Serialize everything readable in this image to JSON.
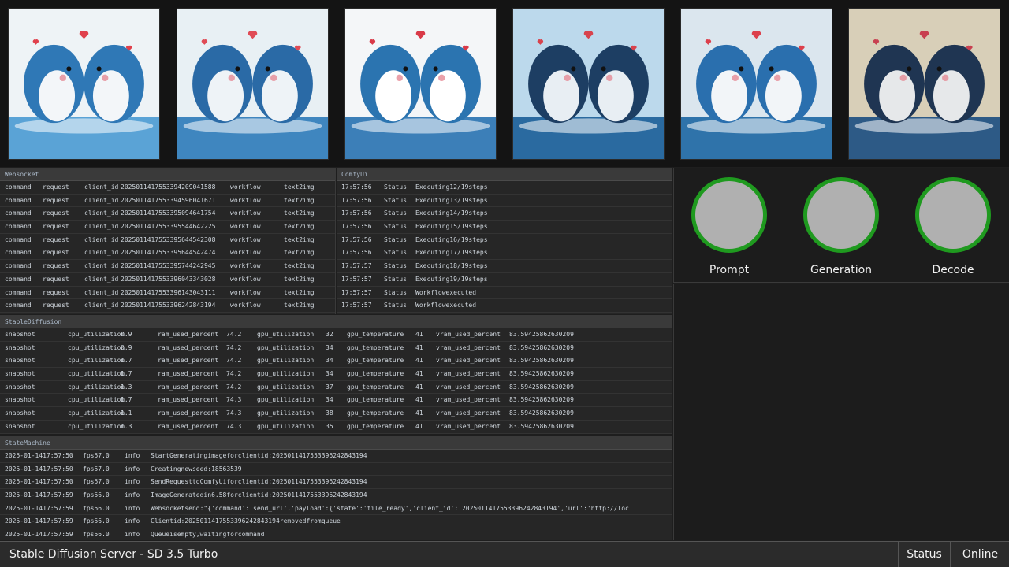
{
  "gallery": {
    "images": [
      {
        "description": "whales-heart-1"
      },
      {
        "description": "whales-heart-2"
      },
      {
        "description": "whales-heart-3"
      },
      {
        "description": "whales-heart-4"
      },
      {
        "description": "whales-heart-5"
      },
      {
        "description": "whales-heart-6"
      }
    ]
  },
  "websocket": {
    "title": "Websocket",
    "rows": [
      [
        "command",
        "request",
        "client_id",
        "20250114175533942090415 88",
        "workflow",
        "text2img"
      ],
      [
        "command",
        "request",
        "client_id",
        "20250114175533945960416 71",
        "workflow",
        "text2img"
      ],
      [
        "command",
        "request",
        "client_id",
        "20250114175533950946417 54",
        "workflow",
        "text2img"
      ],
      [
        "command",
        "request",
        "client_id",
        "20250114175533955446422 25",
        "workflow",
        "text2img"
      ],
      [
        "command",
        "request",
        "client_id",
        "20250114175533956445423 08",
        "workflow",
        "text2img"
      ],
      [
        "command",
        "request",
        "client_id",
        "20250114175533956445424 74",
        "workflow",
        "text2img"
      ],
      [
        "command",
        "request",
        "client_id",
        "20250114175533957442429 45",
        "workflow",
        "text2img"
      ],
      [
        "command",
        "request",
        "client_id",
        "20250114175533960433430 28",
        "workflow",
        "text2img"
      ],
      [
        "command",
        "request",
        "client_id",
        "20250114175533961430431 11",
        "workflow",
        "text2img"
      ],
      [
        "command",
        "request",
        "client_id",
        "20250114175533962428431 94",
        "workflow",
        "text2img"
      ]
    ]
  },
  "comfyui": {
    "title": "ComfyUi",
    "rows": [
      [
        "17:57:56",
        "Status",
        "Executing 12/19 steps"
      ],
      [
        "17:57:56",
        "Status",
        "Executing 13/19 steps"
      ],
      [
        "17:57:56",
        "Status",
        "Executing 14/19 steps"
      ],
      [
        "17:57:56",
        "Status",
        "Executing 15/19 steps"
      ],
      [
        "17:57:56",
        "Status",
        "Executing 16/19 steps"
      ],
      [
        "17:57:56",
        "Status",
        "Executing 17/19 steps"
      ],
      [
        "17:57:57",
        "Status",
        "Executing 18/19 steps"
      ],
      [
        "17:57:57",
        "Status",
        "Executing 19/19 steps"
      ],
      [
        "17:57:57",
        "Status",
        "Workflow executed"
      ],
      [
        "17:57:57",
        "Status",
        "Workflow executed"
      ]
    ]
  },
  "stablediffusion": {
    "title": "StableDiffusion",
    "rows": [
      [
        "snapshot",
        "cpu_utilization",
        "0.9",
        "ram_used_percent",
        "74.2",
        "gpu_utilization",
        "32",
        "gpu_temperature",
        "41",
        "vram_used_percent",
        "83.59425862630209"
      ],
      [
        "snapshot",
        "cpu_utilization",
        "0.9",
        "ram_used_percent",
        "74.2",
        "gpu_utilization",
        "34",
        "gpu_temperature",
        "41",
        "vram_used_percent",
        "83.59425862630209"
      ],
      [
        "snapshot",
        "cpu_utilization",
        "1.7",
        "ram_used_percent",
        "74.2",
        "gpu_utilization",
        "34",
        "gpu_temperature",
        "41",
        "vram_used_percent",
        "83.59425862630209"
      ],
      [
        "snapshot",
        "cpu_utilization",
        "1.7",
        "ram_used_percent",
        "74.2",
        "gpu_utilization",
        "34",
        "gpu_temperature",
        "41",
        "vram_used_percent",
        "83.59425862630209"
      ],
      [
        "snapshot",
        "cpu_utilization",
        "1.3",
        "ram_used_percent",
        "74.2",
        "gpu_utilization",
        "37",
        "gpu_temperature",
        "41",
        "vram_used_percent",
        "83.59425862630209"
      ],
      [
        "snapshot",
        "cpu_utilization",
        "1.7",
        "ram_used_percent",
        "74.3",
        "gpu_utilization",
        "34",
        "gpu_temperature",
        "41",
        "vram_used_percent",
        "83.59425862630209"
      ],
      [
        "snapshot",
        "cpu_utilization",
        "1.1",
        "ram_used_percent",
        "74.3",
        "gpu_utilization",
        "38",
        "gpu_temperature",
        "41",
        "vram_used_percent",
        "83.59425862630209"
      ],
      [
        "snapshot",
        "cpu_utilization",
        "1.3",
        "ram_used_percent",
        "74.3",
        "gpu_utilization",
        "35",
        "gpu_temperature",
        "41",
        "vram_used_percent",
        "83.59425862630209"
      ]
    ]
  },
  "statemachine": {
    "title": "StateMachine",
    "rows": [
      [
        "2025-01-14 17:57:50",
        "fps 57.0",
        "info",
        "Start Generating image for client id: 20250114175533962428431 94"
      ],
      [
        "2025-01-14 17:57:50",
        "fps 57.0",
        "info",
        "Creating new seed : 18563539"
      ],
      [
        "2025-01-14 17:57:50",
        "fps 57.0",
        "info",
        "Send Request to ComfyUi for client id: 20250114175533962428431 94"
      ],
      [
        "2025-01-14 17:57:59",
        "fps 56.0",
        "info",
        "Image Generated in 6.58 for client id: 20250114175533962428431 94"
      ],
      [
        "2025-01-14 17:57:59",
        "fps 56.0",
        "info",
        "Websocket send : \"{'command': 'send_url', 'payload': {'state': 'file_ready', 'client_id': '20250114175533962428431 94', 'url': 'http://loc"
      ],
      [
        "2025-01-14 17:57:59",
        "fps 56.0",
        "info",
        "Client id: 20250114175533962428431 94 removed from queue"
      ],
      [
        "2025-01-14 17:57:59",
        "fps 56.0",
        "info",
        "Queue is empty, waiting for command"
      ]
    ]
  },
  "indicators": [
    {
      "label": "Prompt",
      "color": "#1f9a1f"
    },
    {
      "label": "Generation",
      "color": "#1f9a1f"
    },
    {
      "label": "Decode",
      "color": "#1f9a1f"
    }
  ],
  "statusbar": {
    "title": "Stable Diffusion Server - SD 3.5 Turbo",
    "status_label": "Status",
    "status_value": "Online"
  }
}
